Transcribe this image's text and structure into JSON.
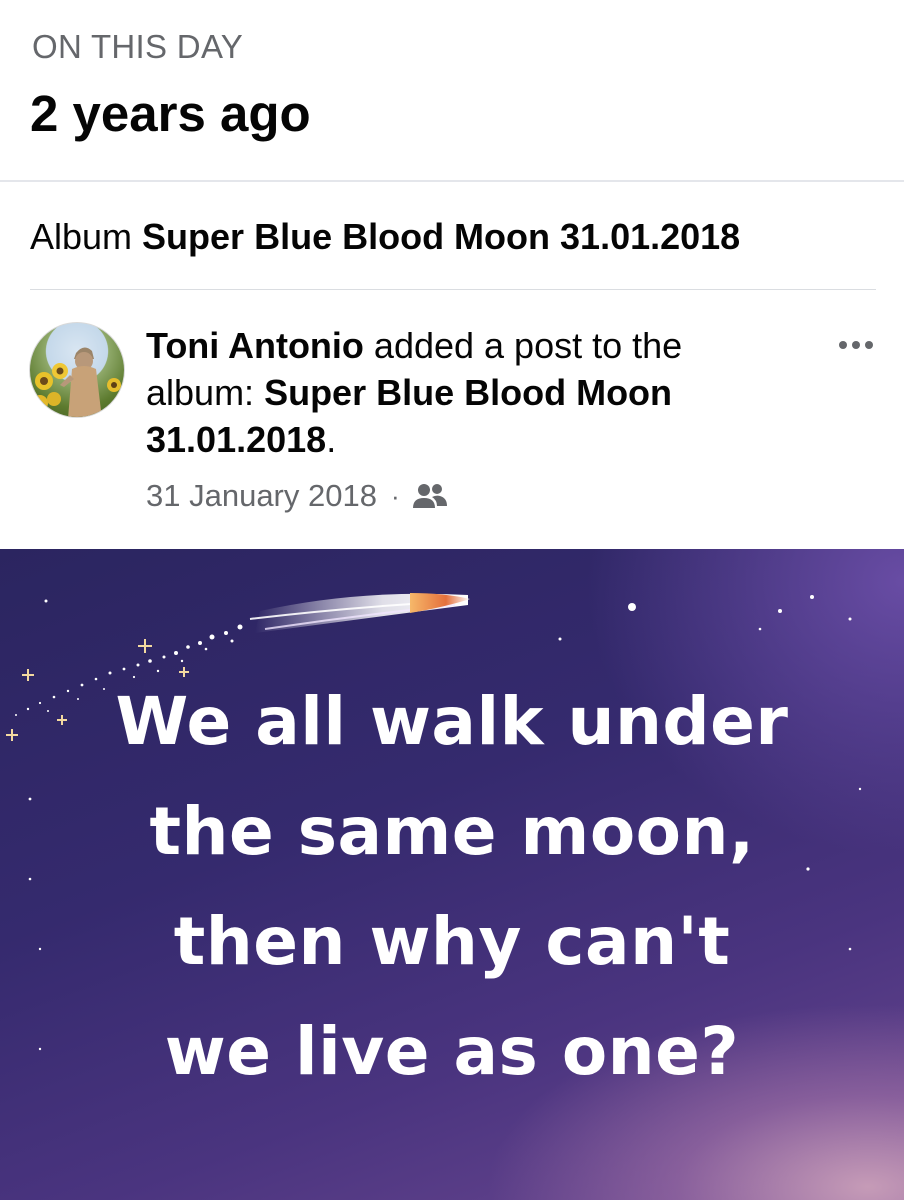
{
  "memory": {
    "eyebrow": "ON THIS DAY",
    "title": "2 years ago"
  },
  "album": {
    "prefix": "Album ",
    "name": "Super Blue Blood Moon 31.01.2018"
  },
  "post": {
    "author": "Toni Antonio",
    "action": " added a post to the album: ",
    "album_name": "Super Blue Blood Moon 31.01.2018",
    "period": ".",
    "date": "31 January 2018",
    "separator": "·",
    "audience_icon": "friends-icon",
    "more_icon": "more-options-icon"
  },
  "image": {
    "quote_lines": [
      "We all walk under",
      "the same moon,",
      "then why can't",
      "we live as one?"
    ],
    "colors": {
      "background_top": "#2b2560",
      "background_bottom": "#6b4891",
      "text": "#ffffff"
    }
  }
}
